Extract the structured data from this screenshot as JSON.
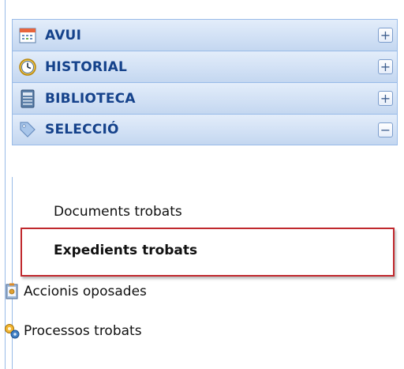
{
  "accordion": {
    "panels": [
      {
        "title": "AVUI",
        "toggle": "+",
        "icon": "calendar-icon"
      },
      {
        "title": "HISTORIAL",
        "toggle": "+",
        "icon": "clock-icon"
      },
      {
        "title": "BIBLIOTECA",
        "toggle": "+",
        "icon": "book-icon"
      },
      {
        "title": "SELECCIÓ",
        "toggle": "−",
        "icon": "tag-icon"
      }
    ]
  },
  "selection": {
    "items": [
      {
        "label": "Documents trobats"
      },
      {
        "label": "Expedients trobats"
      },
      {
        "label": "Accionis oposades",
        "icon": "notebook-icon"
      },
      {
        "label": "Processos trobats",
        "icon": "gears-icon"
      }
    ]
  },
  "colors": {
    "header_text": "#15428b",
    "border": "#99bbe8",
    "highlight": "#c0282d"
  }
}
